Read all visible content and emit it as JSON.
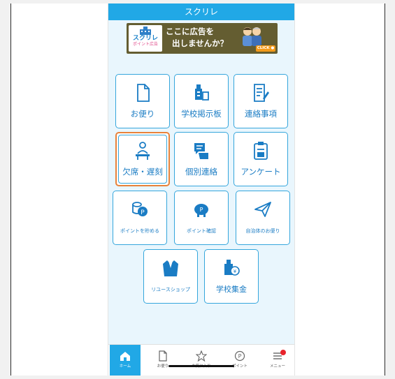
{
  "app": {
    "title": "スクリレ"
  },
  "ad": {
    "logo_line1": "スクリレ",
    "logo_line2": "ポイント広告",
    "line1": "ここに広告を",
    "line2": "出しませんか？",
    "click": "CLICK ●"
  },
  "tiles": [
    {
      "label": "お便り",
      "icon": "document-icon"
    },
    {
      "label": "学校掲示板",
      "icon": "bulletin-board-icon"
    },
    {
      "label": "連絡事項",
      "icon": "notice-list-icon"
    },
    {
      "label": "欠席・遅刻",
      "icon": "person-at-desk-icon"
    },
    {
      "label": "個別連絡",
      "icon": "chat-bubbles-icon"
    },
    {
      "label": "アンケート",
      "icon": "survey-clipboard-icon"
    },
    {
      "label": "ポイントを貯める",
      "icon": "coin-stack-icon"
    },
    {
      "label": "ポイント確認",
      "icon": "piggy-bank-icon"
    },
    {
      "label": "自治体のお便り",
      "icon": "paper-plane-icon"
    },
    {
      "label": "リユースショップ",
      "icon": "jacket-icon"
    },
    {
      "label": "学校集金",
      "icon": "school-money-icon"
    }
  ],
  "bottom_nav": [
    {
      "label": "ホーム",
      "icon": "home-icon",
      "active": true
    },
    {
      "label": "お便り",
      "icon": "document-icon"
    },
    {
      "label": "お気に入り",
      "icon": "star-icon"
    },
    {
      "label": "ポイント",
      "icon": "point-coin-icon"
    },
    {
      "label": "メニュー",
      "icon": "menu-icon",
      "badge": true
    }
  ],
  "colors": {
    "primary": "#21a8e6",
    "tile_border": "#35a6dc",
    "label": "#1a7cc4",
    "selected": "#e8823a",
    "badge": "#e8242c"
  }
}
